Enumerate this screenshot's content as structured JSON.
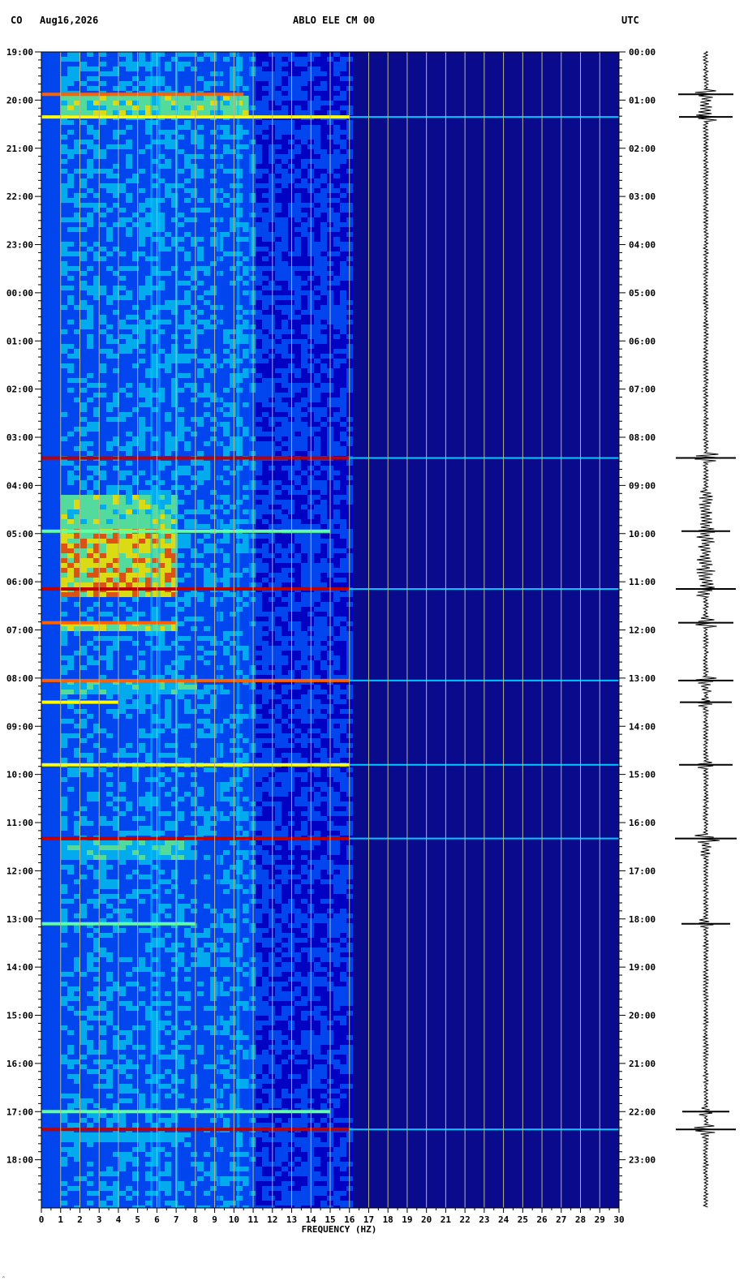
{
  "header": {
    "network": "CO",
    "date": "Aug16,2026",
    "station": "ABLO ELE CM 00",
    "tz": "UTC"
  },
  "footer_mark": "ᐢ",
  "chart_data": {
    "type": "heatmap",
    "title": "ABLO ELE CM 00",
    "xlabel": "FREQUENCY (HZ)",
    "x_range": [
      0,
      30
    ],
    "x_ticks": [
      "0",
      "1",
      "2",
      "3",
      "4",
      "5",
      "6",
      "7",
      "8",
      "9",
      "10",
      "11",
      "12",
      "13",
      "14",
      "15",
      "16",
      "17",
      "18",
      "19",
      "20",
      "21",
      "22",
      "23",
      "24",
      "25",
      "26",
      "27",
      "28",
      "29",
      "30"
    ],
    "left_axis_labels": [
      "19:00",
      "20:00",
      "21:00",
      "22:00",
      "23:00",
      "00:00",
      "01:00",
      "02:00",
      "03:00",
      "04:00",
      "05:00",
      "06:00",
      "07:00",
      "08:00",
      "09:00",
      "10:00",
      "11:00",
      "12:00",
      "13:00",
      "14:00",
      "15:00",
      "16:00",
      "17:00",
      "18:00"
    ],
    "right_axis_labels": [
      "00:00",
      "01:00",
      "02:00",
      "03:00",
      "04:00",
      "05:00",
      "06:00",
      "07:00",
      "08:00",
      "09:00",
      "10:00",
      "11:00",
      "12:00",
      "13:00",
      "14:00",
      "15:00",
      "16:00",
      "17:00",
      "18:00",
      "19:00",
      "20:00",
      "21:00",
      "22:00",
      "23:00"
    ],
    "hours_span": 24,
    "gridlines": "vertical every 1 Hz",
    "colormap": [
      "#00008b",
      "#0000cd",
      "#0050ff",
      "#00c8ff",
      "#60ffa0",
      "#ffff00",
      "#ff6000",
      "#c00000"
    ],
    "background_color": "#0a0a8c",
    "events": [
      {
        "hour": 0.88,
        "fmax": 10.5,
        "strength": 0.8
      },
      {
        "hour": 1.35,
        "fmax": 30,
        "strength": 0.75
      },
      {
        "hour": 8.43,
        "fmax": 30,
        "strength": 0.95
      },
      {
        "hour": 9.95,
        "fmax": 15,
        "strength": 0.6
      },
      {
        "hour": 11.15,
        "fmax": 30,
        "strength": 0.95
      },
      {
        "hour": 11.85,
        "fmax": 7,
        "strength": 0.8
      },
      {
        "hour": 13.05,
        "fmax": 30,
        "strength": 0.8
      },
      {
        "hour": 13.5,
        "fmax": 4,
        "strength": 0.7
      },
      {
        "hour": 14.8,
        "fmax": 30,
        "strength": 0.75
      },
      {
        "hour": 16.33,
        "fmax": 30,
        "strength": 1.0
      },
      {
        "hour": 18.1,
        "fmax": 8,
        "strength": 0.6
      },
      {
        "hour": 22.0,
        "fmax": 15,
        "strength": 0.55
      },
      {
        "hour": 22.37,
        "fmax": 30,
        "strength": 0.95
      }
    ],
    "active_blocks": [
      {
        "h0": 0.85,
        "h1": 1.25,
        "f0": 1.0,
        "f1": 10.5,
        "level": 0.62
      },
      {
        "h0": 9.1,
        "h1": 9.9,
        "f0": 1.0,
        "f1": 7.0,
        "level": 0.6
      },
      {
        "h0": 9.9,
        "h1": 11.3,
        "f0": 1.0,
        "f1": 7.0,
        "level": 0.78
      },
      {
        "h0": 11.75,
        "h1": 11.95,
        "f0": 1.0,
        "f1": 7.0,
        "level": 0.7
      },
      {
        "h0": 13.0,
        "h1": 13.3,
        "f0": 1.0,
        "f1": 8.0,
        "level": 0.5
      },
      {
        "h0": 16.3,
        "h1": 16.7,
        "f0": 1.0,
        "f1": 7.5,
        "level": 0.5
      },
      {
        "h0": 22.35,
        "h1": 22.55,
        "f0": 1.0,
        "f1": 7.5,
        "level": 0.45
      }
    ]
  }
}
